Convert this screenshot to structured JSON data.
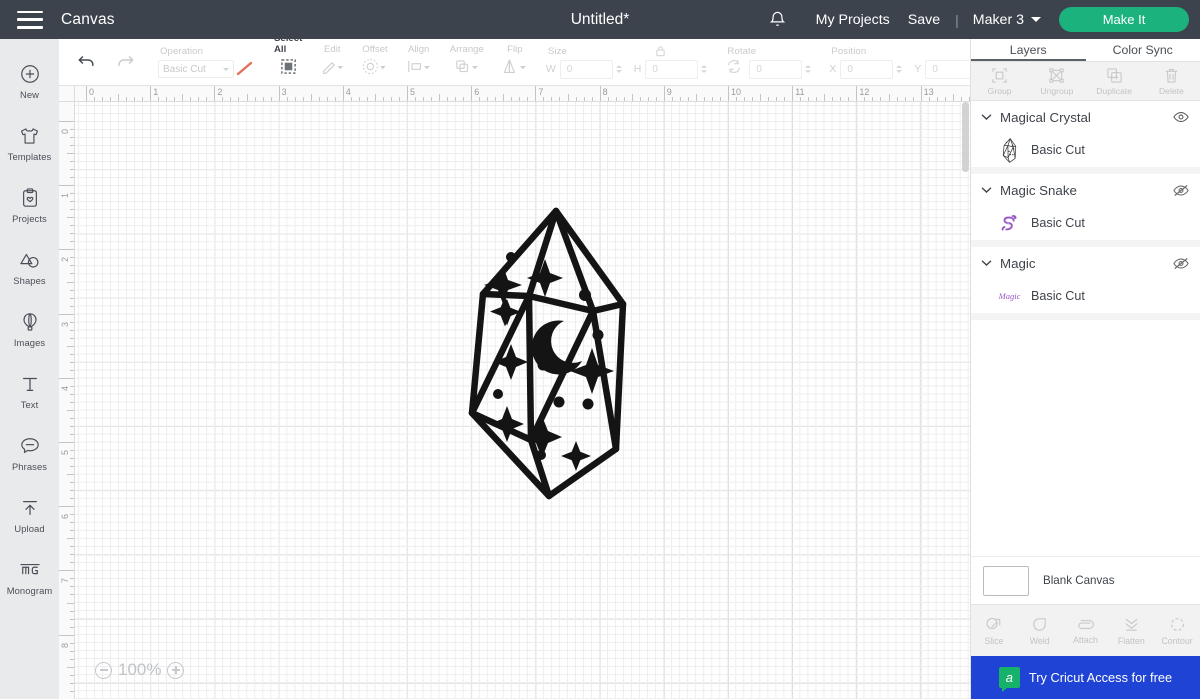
{
  "header": {
    "menu_icon": "hamburger-icon",
    "canvas_label": "Canvas",
    "doc_title": "Untitled*",
    "bell_icon": "notification-bell-icon",
    "my_projects": "My Projects",
    "save": "Save",
    "separator": "|",
    "machine": "Maker 3",
    "machine_chevron": "chevron-down-icon",
    "make_it": "Make It",
    "bg_color": "#3c434d",
    "accent_green": "#1bb27e"
  },
  "sidebar": {
    "items": [
      {
        "label": "New",
        "icon": "plus-circle-icon"
      },
      {
        "label": "Templates",
        "icon": "tshirt-icon"
      },
      {
        "label": "Projects",
        "icon": "clipboard-heart-icon"
      },
      {
        "label": "Shapes",
        "icon": "shapes-icon"
      },
      {
        "label": "Images",
        "icon": "hot-air-balloon-icon"
      },
      {
        "label": "Text",
        "icon": "text-t-icon"
      },
      {
        "label": "Phrases",
        "icon": "speech-bubble-icon"
      },
      {
        "label": "Upload",
        "icon": "upload-arrow-icon"
      },
      {
        "label": "Monogram",
        "icon": "monogram-icon"
      }
    ]
  },
  "toolbar": {
    "undo_icon": "undo-arrow-icon",
    "redo_icon": "redo-arrow-icon",
    "operation_caption": "Operation",
    "operation_value": "Basic Cut",
    "operation_chevron": "chevron-down-icon",
    "color_swatch_icon": "line-color-swatch-icon",
    "select_all": "Select All",
    "select_all_icon": "select-all-icon",
    "edit": "Edit",
    "edit_icon": "pencil-icon",
    "offset": "Offset",
    "offset_icon": "offset-sun-icon",
    "align": "Align",
    "align_icon": "align-icon",
    "arrange": "Arrange",
    "arrange_icon": "arrange-layers-icon",
    "flip": "Flip",
    "flip_icon": "flip-icon",
    "size_caption": "Size",
    "lock_icon": "lock-closed-icon",
    "w_label": "W",
    "w_value": "0",
    "h_label": "H",
    "h_value": "0",
    "rotate_caption": "Rotate",
    "rotate_icon": "rotate-icon",
    "rotate_value": "0",
    "position_caption": "Position",
    "x_label": "X",
    "x_value": "0",
    "y_label": "Y",
    "y_value": "0"
  },
  "canvas": {
    "ruler_h_labels": [
      "0",
      "1",
      "2",
      "3",
      "4",
      "5",
      "6",
      "7",
      "8",
      "9",
      "10",
      "11",
      "12",
      "13"
    ],
    "ruler_v_labels": [
      "0",
      "1",
      "2",
      "3",
      "4",
      "5",
      "6",
      "7",
      "8"
    ],
    "zoom_level": "100%",
    "zoom_out_icon": "minus-circle-icon",
    "zoom_in_icon": "plus-circle-icon",
    "artwork_name": "magical-crystal-artwork"
  },
  "right_panel": {
    "tabs": [
      {
        "label": "Layers",
        "active": true
      },
      {
        "label": "Color Sync",
        "active": false
      }
    ],
    "tools": [
      {
        "label": "Group",
        "icon": "group-icon"
      },
      {
        "label": "Ungroup",
        "icon": "ungroup-icon"
      },
      {
        "label": "Duplicate",
        "icon": "duplicate-icon"
      },
      {
        "label": "Delete",
        "icon": "trash-icon"
      }
    ],
    "layers": [
      {
        "name": "Magical Crystal",
        "visible": true,
        "eye_icon": "eye-visible-icon",
        "chevron": "chevron-down-icon",
        "child": {
          "label": "Basic Cut",
          "thumb": "crystal-thumbnail"
        }
      },
      {
        "name": "Magic Snake",
        "visible": false,
        "eye_icon": "eye-hidden-icon",
        "chevron": "chevron-down-icon",
        "child": {
          "label": "Basic Cut",
          "thumb": "snake-thumbnail"
        }
      },
      {
        "name": "Magic",
        "visible": false,
        "eye_icon": "eye-hidden-icon",
        "chevron": "chevron-down-icon",
        "child": {
          "label": "Basic Cut",
          "thumb": "magic-text-thumbnail"
        }
      }
    ],
    "canvas_selector": {
      "label": "Blank Canvas",
      "swatch_color": "#ffffff"
    },
    "bottom_tools": [
      {
        "label": "Slice",
        "icon": "slice-icon"
      },
      {
        "label": "Weld",
        "icon": "weld-icon"
      },
      {
        "label": "Attach",
        "icon": "attach-paperclip-icon"
      },
      {
        "label": "Flatten",
        "icon": "flatten-icon"
      },
      {
        "label": "Contour",
        "icon": "contour-dashed-circle-icon"
      }
    ],
    "access_banner": {
      "text": "Try Cricut Access for free",
      "badge": "a",
      "bg_color": "#1f43d4"
    }
  }
}
